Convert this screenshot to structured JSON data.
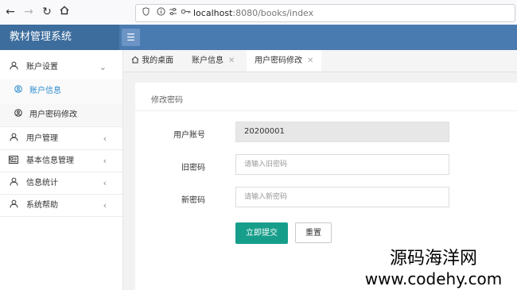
{
  "browser": {
    "back_icon": "arrow-left-icon",
    "forward_icon": "arrow-right-icon",
    "reload_icon": "reload-icon",
    "home_icon": "home-icon",
    "url_host": "localhost",
    "url_rest": ":8080/books/index"
  },
  "app": {
    "title": "教材管理系统",
    "menu_icon": "hamburger-icon"
  },
  "sidebar": {
    "items": [
      {
        "label": "账户设置",
        "icon": "user-icon",
        "expanded": true
      },
      {
        "label": "账户信息",
        "icon": "user-circle-icon",
        "active": true
      },
      {
        "label": "用户密码修改",
        "icon": "user-circle-icon"
      },
      {
        "label": "用户管理",
        "icon": "user-icon"
      },
      {
        "label": "基本信息管理",
        "icon": "id-card-icon"
      },
      {
        "label": "信息统计",
        "icon": "user-icon"
      },
      {
        "label": "系统帮助",
        "icon": "user-icon"
      }
    ]
  },
  "tabs": [
    {
      "label": "我的桌面",
      "icon": "home-icon"
    },
    {
      "label": "账户信息"
    },
    {
      "label": "用户密码修改",
      "active": true
    }
  ],
  "form": {
    "title": "修改密码",
    "account_label": "用户账号",
    "account_value": "20200001",
    "old_label": "旧密码",
    "old_placeholder": "请输入旧密码",
    "new_label": "新密码",
    "new_placeholder": "请输入新密码",
    "submit_label": "立即提交",
    "reset_label": "重置"
  },
  "watermark": {
    "line1": "源码海洋网",
    "line2": "www.codehy.com"
  },
  "colors": {
    "header": "#4a7bb0",
    "logo_bg": "#3c6d9d",
    "primary_button": "#179e8b",
    "active_link": "#2d8ccf"
  }
}
